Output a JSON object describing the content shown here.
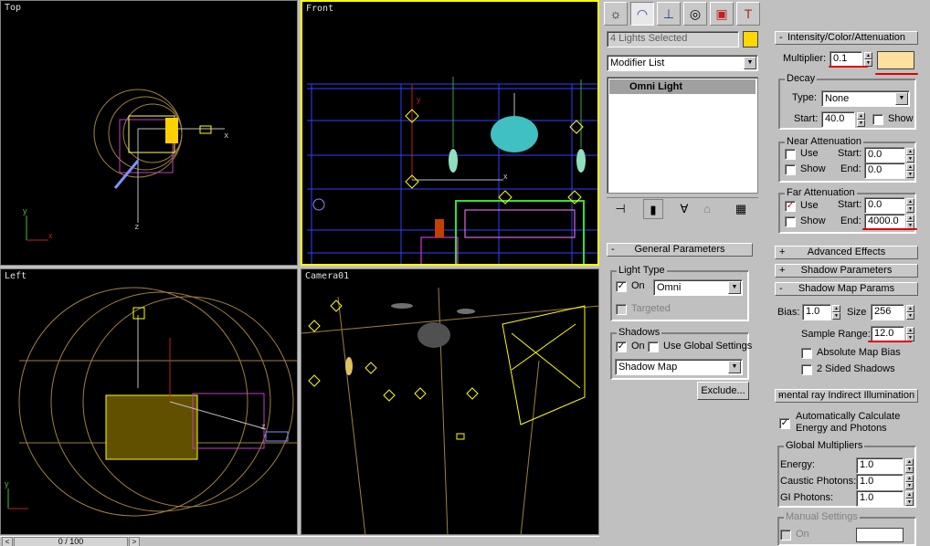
{
  "viewports": {
    "top": "Top",
    "front": "Front",
    "left": "Left",
    "camera": "Camera01"
  },
  "timeline": {
    "frame": "0 / 100",
    "prev": "<",
    "next": ">"
  },
  "tabs": [
    "create-icon",
    "modify-icon",
    "hierarchy-icon",
    "motion-icon",
    "display-icon",
    "utilities-icon"
  ],
  "selection": {
    "name": "4 Lights Selected",
    "color": "#ffd700"
  },
  "modifier_list": "Modifier List",
  "stack_item": "Omni Light",
  "general": {
    "title": "General Parameters",
    "sign": "-",
    "light_type_group": "Light Type",
    "on_label": "On",
    "type_value": "Omni",
    "targeted_label": "Targeted",
    "shadows_group": "Shadows",
    "shadows_on_label": "On",
    "use_global_label": "Use Global Settings",
    "shadow_type": "Shadow Map",
    "exclude_label": "Exclude..."
  },
  "intensity": {
    "title": "Intensity/Color/Attenuation",
    "sign": "-",
    "multiplier_label": "Multiplier:",
    "multiplier_value": "0.1",
    "light_color": "#ffe0a0",
    "decay_group": "Decay",
    "type_label": "Type:",
    "type_value": "None",
    "start_label": "Start:",
    "decay_start": "40.0",
    "show_label": "Show",
    "near_group": "Near Attenuation",
    "use_label": "Use",
    "near_show_label": "Show",
    "near_start_label": "Start:",
    "near_start": "0.0",
    "near_end_label": "End:",
    "near_end": "0.0",
    "far_group": "Far Attenuation",
    "far_use_label": "Use",
    "far_show_label": "Show",
    "far_start_label": "Start:",
    "far_start": "0.0",
    "far_end_label": "End:",
    "far_end": "4000.0"
  },
  "advanced_effects": {
    "title": "Advanced Effects",
    "sign": "+"
  },
  "shadow_parameters": {
    "title": "Shadow Parameters",
    "sign": "+"
  },
  "shadow_map": {
    "title": "Shadow Map Params",
    "sign": "-",
    "bias_label": "Bias:",
    "bias": "1.0",
    "size_label": "Size",
    "size": "256",
    "sample_label": "Sample Range:",
    "sample": "12.0",
    "absolute_label": "Absolute Map Bias",
    "two_sided_label": "2 Sided Shadows"
  },
  "mental_ray": {
    "title": "mental ray Indirect Illumination",
    "sign": "-",
    "auto_label": "Automatically Calculate",
    "auto_label2": "Energy and Photons",
    "global_group": "Global Multipliers",
    "energy_label": "Energy:",
    "energy": "1.0",
    "caustic_label": "Caustic Photons:",
    "caustic": "1.0",
    "gi_label": "GI Photons:",
    "gi": "1.0",
    "manual_group": "Manual Settings",
    "manual_on_label": "On"
  }
}
